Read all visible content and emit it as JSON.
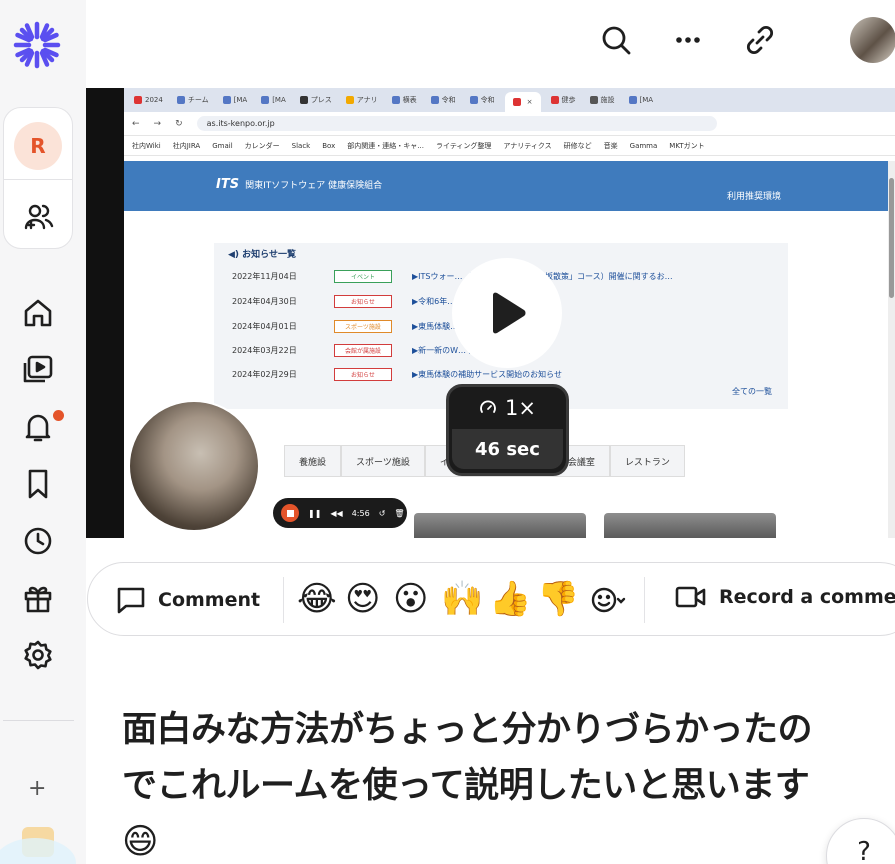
{
  "sidebar": {
    "workspace_initial": "R",
    "items": [
      {
        "icon": "home-icon"
      },
      {
        "icon": "library-icon"
      },
      {
        "icon": "bell-icon"
      },
      {
        "icon": "bookmark-icon"
      },
      {
        "icon": "clock-icon"
      },
      {
        "icon": "gift-icon"
      },
      {
        "icon": "gear-icon"
      }
    ],
    "add_label": "+",
    "accent": "#4f46e5",
    "notification_color": "#e4542a"
  },
  "topbar": {
    "icons": [
      "search-icon",
      "more-icon",
      "link-icon"
    ]
  },
  "video": {
    "browser": {
      "tabs": [
        "2024",
        "チーム",
        "[MA",
        "[MA",
        "プレス",
        "アナリ",
        "横表",
        "令和",
        "令和",
        "",
        "健歩",
        "施設",
        "[MA"
      ],
      "url": "as.its-kenpo.or.jp",
      "bookmarks": [
        "社内Wiki",
        "社内JIRA",
        "Gmail",
        "カレンダー",
        "Slack",
        "Box",
        "部内関連・連絡・キャ...",
        "ライティング整理",
        "アナリティクス",
        "研修など",
        "音楽",
        "Gamma",
        "MKTガント"
      ]
    },
    "site": {
      "logo_text": "ITS",
      "org_name": "関東ITソフトウェア 健康保険組合",
      "env_link": "利用推奨環境",
      "news_title": "お知らせ一覧",
      "news": [
        {
          "date": "2022年11月04日",
          "tag": "イベント",
          "tag_color": "#3aa05a",
          "text": "▶ITSウォー… 「新宿御苑〜四谷・赤坂散策」コース）開催に関するお…"
        },
        {
          "date": "2024年04月30日",
          "tag": "お知らせ",
          "tag_color": "#d23c3c",
          "text": "▶令和6年… ービスのお知らせ"
        },
        {
          "date": "2024年04月01日",
          "tag": "スポーツ施設",
          "tag_color": "#e08a2a",
          "text": "▶東馬体験… らせ"
        },
        {
          "date": "2024年03月22日",
          "tag": "会館が属施設",
          "tag_color": "#d23c3c",
          "text": "▶新一新のW… 開始のお知らせ"
        },
        {
          "date": "2024年02月29日",
          "tag": "お知らせ",
          "tag_color": "#d23c3c",
          "text": "▶東馬体験の補助サービス開始のお知らせ"
        }
      ],
      "news_all": "全ての一覧",
      "categories": [
        "養施設",
        "スポーツ施設",
        "イベ",
        "",
        "会議室",
        "レストラン"
      ]
    },
    "speed": "1×",
    "duration": "46 sec",
    "recorder_time": "4:56"
  },
  "reactions": {
    "comment_label": "Comment",
    "emojis": [
      "😂",
      "😍",
      "😮",
      "🙌",
      "👍",
      "👎"
    ],
    "record_label": "Record a comment"
  },
  "title": {
    "line1": "面白みな方法がちょっと分かりづらかったの",
    "line2": "でこれルームを使って説明したいと思います",
    "emoji": "😄"
  },
  "help_label": "?"
}
